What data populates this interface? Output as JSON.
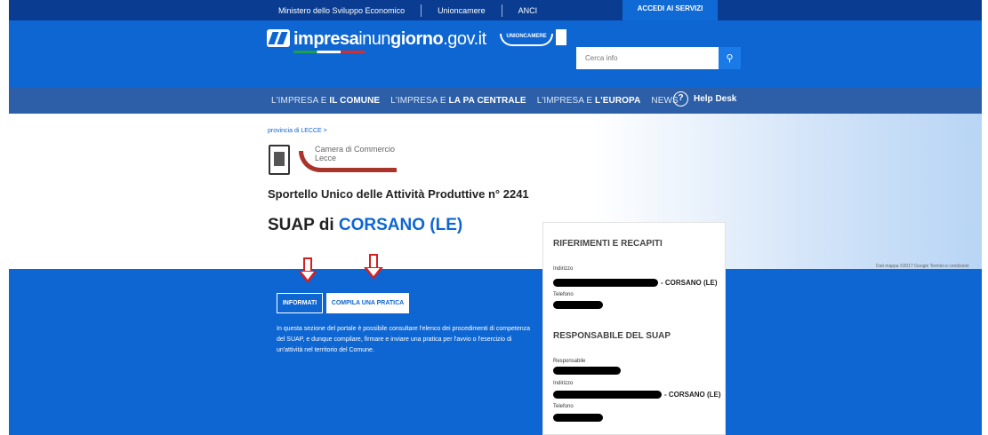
{
  "topbar": {
    "links": [
      "Ministero dello Sviluppo Economico",
      "Unioncamere",
      "ANCI"
    ],
    "accedi": "ACCEDI AI SERVIZI"
  },
  "header": {
    "logo_part1": "impresa",
    "logo_part2": "inun",
    "logo_part3": "giorno",
    "logo_part4": ".gov.it",
    "unioncamere": "UNIONCAMERE",
    "search_placeholder": "Cerca info",
    "search_icon": "search-icon"
  },
  "nav": {
    "items": [
      {
        "prefix": "L'IMPRESA E ",
        "bold": "IL COMUNE"
      },
      {
        "prefix": "L'IMPRESA E ",
        "bold": "LA PA CENTRALE"
      },
      {
        "prefix": "L'IMPRESA E ",
        "bold": "L'EUROPA"
      },
      {
        "prefix": "NEWS",
        "bold": ""
      }
    ],
    "help_icon": "?",
    "help_label": "Help Desk"
  },
  "hero": {
    "breadcrumb": "provincia di LECCE >",
    "chamber_line1": "Camera di Commercio",
    "chamber_line2": "Lecce",
    "sportello": "Sportello Unico delle Attività Produttive n° 2241",
    "suap_prefix": "SUAP di ",
    "suap_city": "CORSANO (LE)",
    "map_attribution": "Dati mappa ©2017 Google  Termini e condizioni"
  },
  "tabs": {
    "informati": "INFORMATI",
    "compila": "COMPILA UNA PRATICA"
  },
  "description": "In questa sezione del portale è possibile consultare l'elenco dei procedimenti di competenza del SUAP, e dunque compilare, firmare e inviare una pratica per l'avvio o l'esercizio di un'attività nel territorio del Comune.",
  "card": {
    "section1_title": "RIFERIMENTI E RECAPITI",
    "indirizzo_label": "Indirizzo",
    "indirizzo_city": "- CORSANO (LE)",
    "telefono_label": "Telefono",
    "section2_title": "RESPONSABILE DEL SUAP",
    "responsabile_label": "Responsabile",
    "indirizzo2_label": "Indirizzo",
    "indirizzo2_city": "- CORSANO (LE)",
    "telefono2_label": "Telefono"
  },
  "colors": {
    "primary_blue": "#0e66d2",
    "dark_blue": "#0a3d91",
    "nav_blue": "#2c5fa8",
    "arrow_red": "#d42020"
  }
}
